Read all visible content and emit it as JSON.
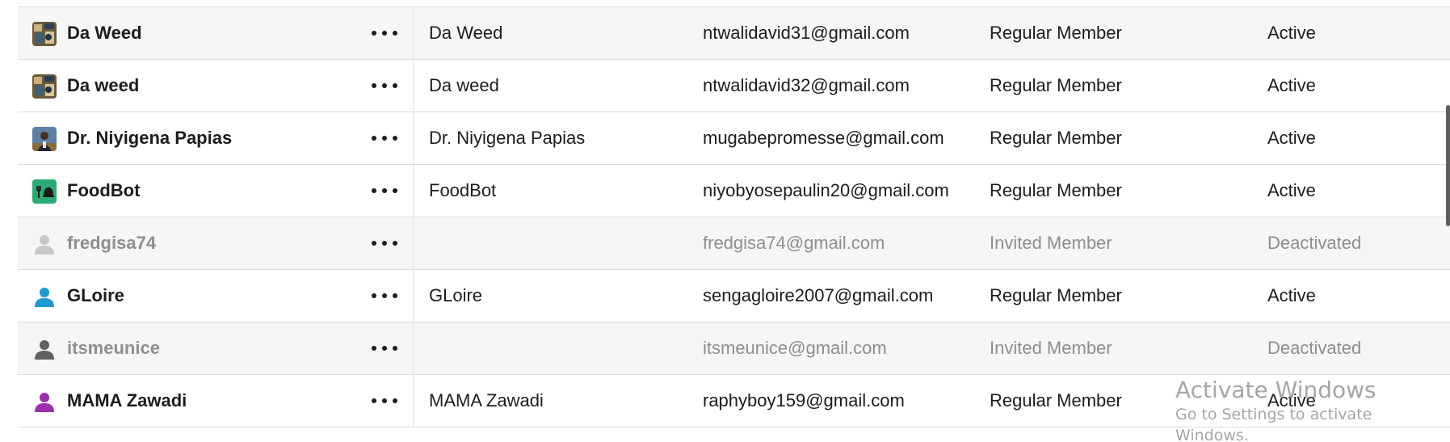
{
  "members": [
    {
      "name": "Da Weed",
      "display_name": "Da Weed",
      "email": "ntwalidavid31@gmail.com",
      "account_type": "Regular Member",
      "status": "Active",
      "avatar": "photo-avatar-art"
    },
    {
      "name": "Da weed",
      "display_name": "Da weed",
      "email": "ntwalidavid32@gmail.com",
      "account_type": "Regular Member",
      "status": "Active",
      "avatar": "photo-avatar-art"
    },
    {
      "name": "Dr. Niyigena Papias",
      "display_name": "Dr. Niyigena Papias",
      "email": "mugabepromesse@gmail.com",
      "account_type": "Regular Member",
      "status": "Active",
      "avatar": "photo-avatar-person"
    },
    {
      "name": "FoodBot",
      "display_name": "FoodBot",
      "email": "niyobyosepaulin20@gmail.com",
      "account_type": "Regular Member",
      "status": "Active",
      "avatar": "bot-avatar-green"
    },
    {
      "name": "fredgisa74",
      "display_name": "",
      "email": "fredgisa74@gmail.com",
      "account_type": "Invited Member",
      "status": "Deactivated",
      "avatar": "default-avatar-lightgray"
    },
    {
      "name": "GLoire",
      "display_name": "GLoire",
      "email": "sengagloire2007@gmail.com",
      "account_type": "Regular Member",
      "status": "Active",
      "avatar": "default-avatar-blue"
    },
    {
      "name": "itsmeunice",
      "display_name": "",
      "email": "itsmeunice@gmail.com",
      "account_type": "Invited Member",
      "status": "Deactivated",
      "avatar": "default-avatar-darkgray"
    },
    {
      "name": "MAMA Zawadi",
      "display_name": "MAMA Zawadi",
      "email": "raphyboy159@gmail.com",
      "account_type": "Regular Member",
      "status": "Active",
      "avatar": "default-avatar-purple"
    }
  ],
  "colors": {
    "row_alt": "#f6f6f6",
    "text": "#1d1c1d",
    "text_muted": "#8e8e8e",
    "avatar_blue": "#1d9bd1",
    "avatar_purple": "#9b2fae",
    "avatar_darkgray": "#616061",
    "avatar_lightgray": "#c8c8c8",
    "bot_green": "#2bac76"
  },
  "watermark": {
    "line1": "Activate Windows",
    "line2": "Go to Settings to activate Windows."
  }
}
